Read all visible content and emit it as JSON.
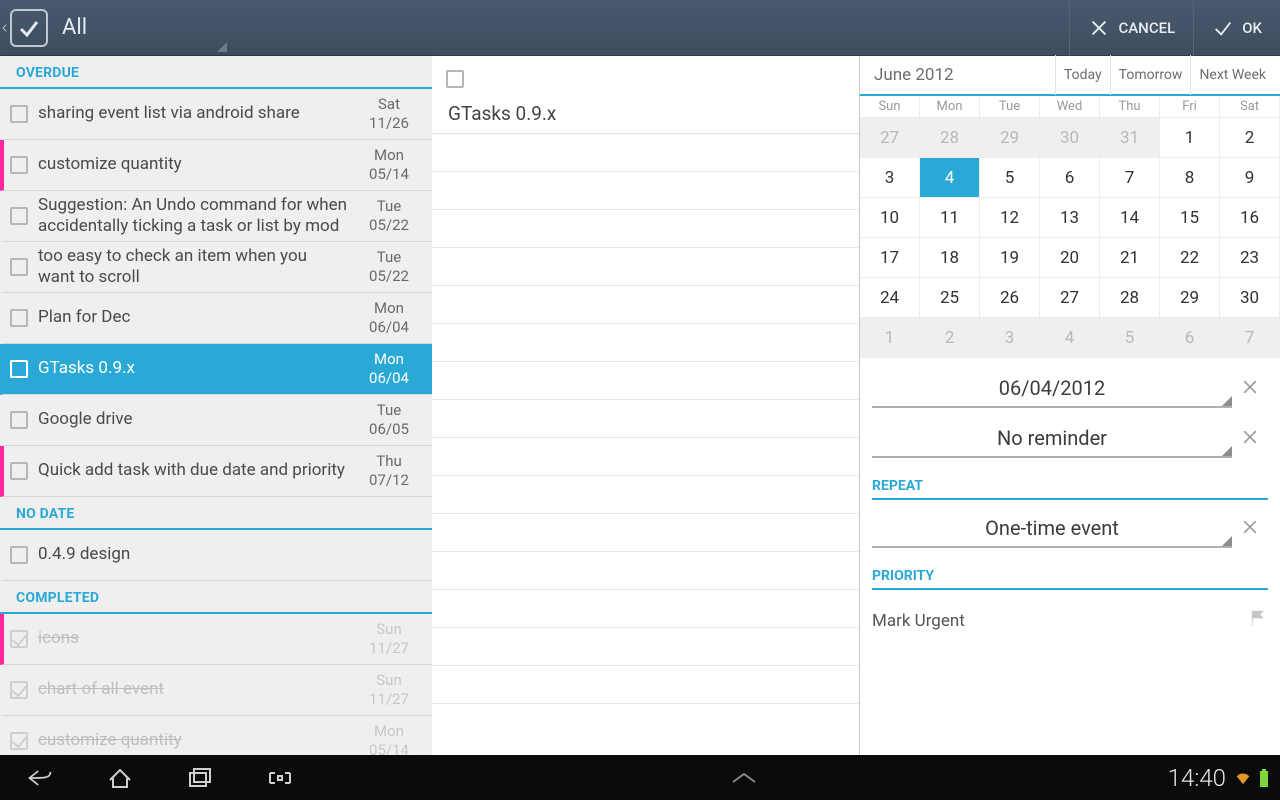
{
  "topbar": {
    "list_label": "All",
    "cancel_label": "CANCEL",
    "ok_label": "OK"
  },
  "sections": {
    "overdue": "OVERDUE",
    "nodate": "NO DATE",
    "completed": "COMPLETED"
  },
  "tasks_overdue": [
    {
      "txt": "sharing event list via android share",
      "dow": "Sat",
      "md": "11/26",
      "prio": false
    },
    {
      "txt": "customize quantity",
      "dow": "Mon",
      "md": "05/14",
      "prio": true
    },
    {
      "txt": "Suggestion: An Undo command for when accidentally ticking a task or list by mod",
      "dow": "Tue",
      "md": "05/22",
      "prio": false
    },
    {
      "txt": "too easy to check an item when you want to scroll",
      "dow": "Tue",
      "md": "05/22",
      "prio": false
    },
    {
      "txt": "Plan for Dec",
      "dow": "Mon",
      "md": "06/04",
      "prio": false
    },
    {
      "txt": "GTasks 0.9.x",
      "dow": "Mon",
      "md": "06/04",
      "prio": false,
      "selected": true
    },
    {
      "txt": "Google drive",
      "dow": "Tue",
      "md": "06/05",
      "prio": false
    },
    {
      "txt": "Quick add task with due date and priority",
      "dow": "Thu",
      "md": "07/12",
      "prio": true
    }
  ],
  "tasks_nodate": [
    {
      "txt": "0.4.9 design",
      "prio": false
    }
  ],
  "tasks_completed": [
    {
      "txt": "icons",
      "dow": "Sun",
      "md": "11/27",
      "prio": true
    },
    {
      "txt": "chart of all event",
      "dow": "Sun",
      "md": "11/27",
      "prio": false
    },
    {
      "txt": "customize quantity",
      "dow": "Mon",
      "md": "05/14",
      "prio": false
    }
  ],
  "mid": {
    "title": "GTasks 0.9.x"
  },
  "calendar": {
    "title": "June 2012",
    "nav": {
      "today": "Today",
      "tomorrow": "Tomorrow",
      "nextweek": "Next Week"
    },
    "dow": [
      "Sun",
      "Mon",
      "Tue",
      "Wed",
      "Thu",
      "Fri",
      "Sat"
    ],
    "days": [
      {
        "n": 27,
        "other": true
      },
      {
        "n": 28,
        "other": true
      },
      {
        "n": 29,
        "other": true
      },
      {
        "n": 30,
        "other": true
      },
      {
        "n": 31,
        "other": true
      },
      {
        "n": 1
      },
      {
        "n": 2
      },
      {
        "n": 3
      },
      {
        "n": 4,
        "sel": true
      },
      {
        "n": 5
      },
      {
        "n": 6
      },
      {
        "n": 7
      },
      {
        "n": 8
      },
      {
        "n": 9
      },
      {
        "n": 10
      },
      {
        "n": 11
      },
      {
        "n": 12
      },
      {
        "n": 13
      },
      {
        "n": 14
      },
      {
        "n": 15
      },
      {
        "n": 16
      },
      {
        "n": 17
      },
      {
        "n": 18
      },
      {
        "n": 19
      },
      {
        "n": 20
      },
      {
        "n": 21
      },
      {
        "n": 22
      },
      {
        "n": 23
      },
      {
        "n": 24
      },
      {
        "n": 25
      },
      {
        "n": 26
      },
      {
        "n": 27
      },
      {
        "n": 28
      },
      {
        "n": 29
      },
      {
        "n": 30
      },
      {
        "n": 1,
        "other": true
      },
      {
        "n": 2,
        "other": true
      },
      {
        "n": 3,
        "other": true
      },
      {
        "n": 4,
        "other": true
      },
      {
        "n": 5,
        "other": true
      },
      {
        "n": 6,
        "other": true
      },
      {
        "n": 7,
        "other": true
      }
    ]
  },
  "details": {
    "date": "06/04/2012",
    "reminder": "No reminder",
    "repeat_label": "REPEAT",
    "repeat_value": "One-time event",
    "priority_label": "PRIORITY",
    "priority_value": "Mark Urgent"
  },
  "sysbar": {
    "time": "14:40"
  }
}
